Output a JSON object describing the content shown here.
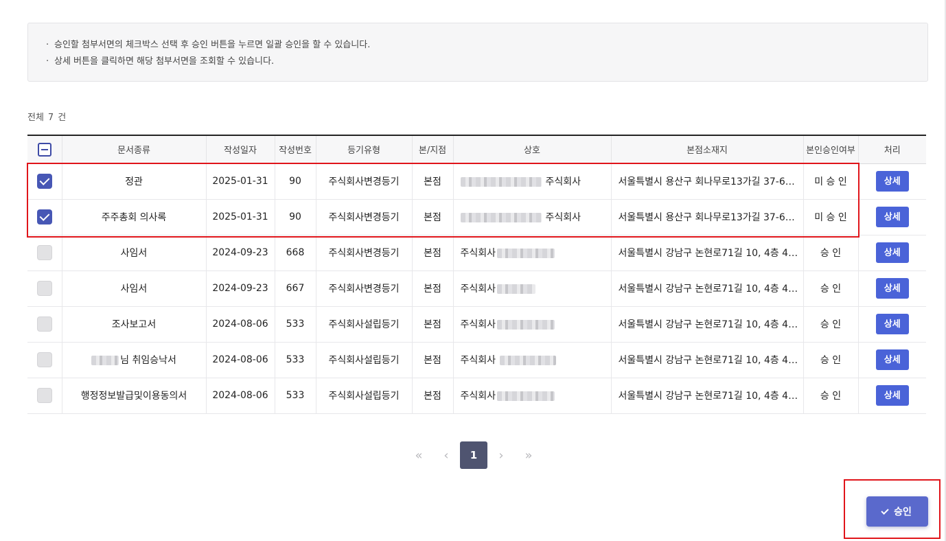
{
  "notice": {
    "bullet": "·",
    "lines": [
      "승인할 첨부서면의 체크박스 선택 후 승인 버튼을 누르면 일괄 승인을 할 수 있습니다.",
      "상세 버튼을 클릭하면 해당 첨부서면을 조회할 수 있습니다."
    ]
  },
  "total": {
    "prefix": "전체",
    "count": "7",
    "suffix": "건"
  },
  "table": {
    "headers": [
      "문서종류",
      "작성일자",
      "작성번호",
      "등기유형",
      "본/지점",
      "상호",
      "본점소재지",
      "본인승인여부",
      "처리"
    ],
    "rows": [
      {
        "checked": true,
        "doc_type": "정관",
        "date": "2025-01-31",
        "number": "90",
        "reg_type": "주식회사변경등기",
        "branch": "본점",
        "company_suffix": "주식회사",
        "address": "서울특별시 용산구 회나무로13가길 37-6…",
        "approval": "미 승 인",
        "action": "상세"
      },
      {
        "checked": true,
        "doc_type": "주주총회 의사록",
        "date": "2025-01-31",
        "number": "90",
        "reg_type": "주식회사변경등기",
        "branch": "본점",
        "company_suffix": "주식회사",
        "address": "서울특별시 용산구 회나무로13가길 37-6…",
        "approval": "미 승 인",
        "action": "상세"
      },
      {
        "checked": false,
        "doc_type": "사임서",
        "date": "2024-09-23",
        "number": "668",
        "reg_type": "주식회사변경등기",
        "branch": "본점",
        "company_prefix": "주식회사",
        "address": "서울특별시 강남구 논현로71길 10, 4층 4…",
        "approval": "승 인",
        "action": "상세"
      },
      {
        "checked": false,
        "doc_type": "사임서",
        "date": "2024-09-23",
        "number": "667",
        "reg_type": "주식회사변경등기",
        "branch": "본점",
        "company_prefix": "주식회사",
        "address": "서울특별시 강남구 논현로71길 10, 4층 4…",
        "approval": "승 인",
        "action": "상세"
      },
      {
        "checked": false,
        "doc_type": "조사보고서",
        "date": "2024-08-06",
        "number": "533",
        "reg_type": "주식회사설립등기",
        "branch": "본점",
        "company_prefix": "주식회사",
        "address": "서울특별시 강남구 논현로71길 10, 4층 4…",
        "approval": "승 인",
        "action": "상세"
      },
      {
        "checked": false,
        "doc_type_suffix": "님 취임승낙서",
        "date": "2024-08-06",
        "number": "533",
        "reg_type": "주식회사설립등기",
        "branch": "본점",
        "company_prefix": "주식회사",
        "address": "서울특별시 강남구 논현로71길 10, 4층 4…",
        "approval": "승 인",
        "action": "상세"
      },
      {
        "checked": false,
        "doc_type": "행정정보발급및이용동의서",
        "date": "2024-08-06",
        "number": "533",
        "reg_type": "주식회사설립등기",
        "branch": "본점",
        "company_prefix": "주식회사",
        "address": "서울특별시 강남구 논현로71길 10, 4층 4…",
        "approval": "승 인",
        "action": "상세"
      }
    ]
  },
  "pagination": {
    "first": "«",
    "prev": "‹",
    "current": "1",
    "next": "›",
    "last": "»"
  },
  "approve_button": {
    "label": "승인"
  },
  "colors": {
    "accent": "#4a63d8",
    "checkbox": "#4757b5",
    "highlight": "#e0141a",
    "active_page": "#4f5470"
  }
}
